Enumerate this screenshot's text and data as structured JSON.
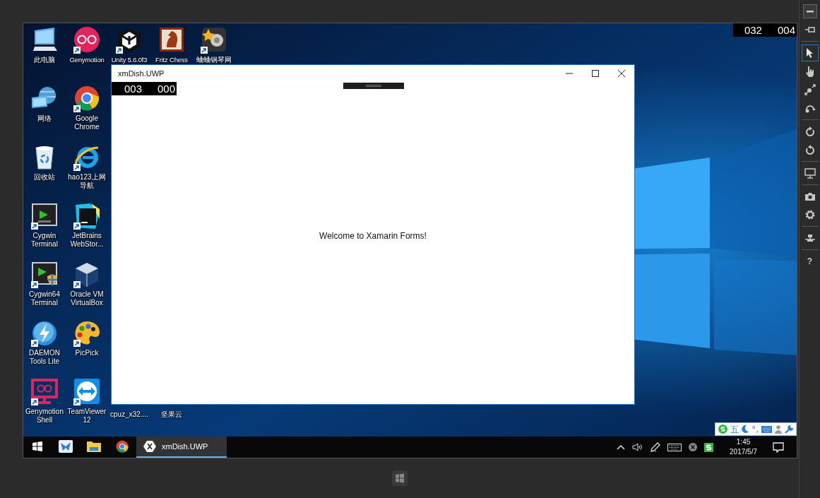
{
  "toolbar": {
    "tools": [
      {
        "kind": "minimize",
        "selected": false
      },
      {
        "kind": "pin",
        "selected": false
      },
      {
        "kind": "separator"
      },
      {
        "kind": "pointer",
        "selected": true
      },
      {
        "kind": "hand",
        "selected": false
      },
      {
        "kind": "pinch",
        "selected": false
      },
      {
        "kind": "rotate-gesture",
        "selected": false
      },
      {
        "kind": "separator"
      },
      {
        "kind": "rotate-right",
        "selected": false
      },
      {
        "kind": "rotate-left",
        "selected": false
      },
      {
        "kind": "separator"
      },
      {
        "kind": "monitor",
        "selected": false
      },
      {
        "kind": "separator"
      },
      {
        "kind": "camera",
        "selected": false
      },
      {
        "kind": "settings",
        "selected": false
      },
      {
        "kind": "separator"
      },
      {
        "kind": "network",
        "selected": false
      },
      {
        "kind": "separator"
      },
      {
        "kind": "help",
        "label": "?",
        "selected": false
      }
    ]
  },
  "screen_counter": [
    "032",
    "004"
  ],
  "desktop": {
    "rows": [
      [
        {
          "kind": "pc",
          "label": "此电脑",
          "shortcut": false
        },
        {
          "kind": "genymotion",
          "label": "Genymotion",
          "shortcut": true
        },
        {
          "kind": "unity",
          "label": "Unity 5.6.0f3",
          "shortcut": true
        },
        {
          "kind": "chess",
          "label": "Fritz Chess",
          "shortcut": false
        },
        {
          "kind": "piano",
          "label": "蛐蛐钢琴网",
          "shortcut": true
        }
      ],
      [
        {
          "kind": "network",
          "label": "网络",
          "shortcut": false
        },
        {
          "kind": "chrome",
          "label": "Google Chrome",
          "shortcut": true
        }
      ],
      [
        {
          "kind": "recycle",
          "label": "回收站",
          "shortcut": false
        },
        {
          "kind": "ie",
          "label": "hao123上网导航",
          "shortcut": true
        }
      ],
      [
        {
          "kind": "terminal",
          "label": "Cygwin Terminal",
          "shortcut": true
        },
        {
          "kind": "webstorm",
          "label": "JetBrains WebStor...",
          "shortcut": true
        }
      ],
      [
        {
          "kind": "terminal64",
          "label": "Cygwin64 Terminal",
          "shortcut": true
        },
        {
          "kind": "virtualbox",
          "label": "Oracle VM VirtualBox",
          "shortcut": true
        }
      ],
      [
        {
          "kind": "daemon",
          "label": "DAEMON Tools Lite",
          "shortcut": true
        },
        {
          "kind": "picpick",
          "label": "PicPick",
          "shortcut": true
        }
      ],
      [
        {
          "kind": "genyshell",
          "label": "Genymotion Shell",
          "shortcut": true
        },
        {
          "kind": "teamviewer",
          "label": "TeamViewer 12",
          "shortcut": true
        },
        {
          "kind": "covered",
          "label": "cpuz_x32....",
          "shortcut": false
        },
        {
          "kind": "covered",
          "label": "坚果云",
          "shortcut": false
        }
      ]
    ]
  },
  "window": {
    "title": "xmDish.UWP",
    "counter": [
      "003",
      "000"
    ],
    "message": "Welcome to Xamarin Forms!"
  },
  "ime_bar": [
    {
      "kind": "sogou"
    },
    {
      "kind": "text",
      "label": "五"
    },
    {
      "kind": "moon"
    },
    {
      "kind": "text",
      "label": "°,"
    },
    {
      "kind": "keyboard"
    },
    {
      "kind": "person"
    },
    {
      "kind": "wrench"
    }
  ],
  "taskbar": {
    "apps": [
      {
        "kind": "start",
        "selected": false
      },
      {
        "kind": "bird",
        "selected": false
      },
      {
        "kind": "explorer",
        "selected": false
      },
      {
        "kind": "chrome",
        "selected": false
      },
      {
        "kind": "xamarin",
        "label": "xmDish.UWP",
        "selected": true
      }
    ],
    "tray": [
      {
        "kind": "chevron"
      },
      {
        "kind": "volume"
      },
      {
        "kind": "pen"
      },
      {
        "kind": "keyboard"
      },
      {
        "kind": "close-circle"
      },
      {
        "kind": "sogou"
      }
    ],
    "clock": {
      "time": "1:45",
      "date": "2017/5/7"
    }
  }
}
